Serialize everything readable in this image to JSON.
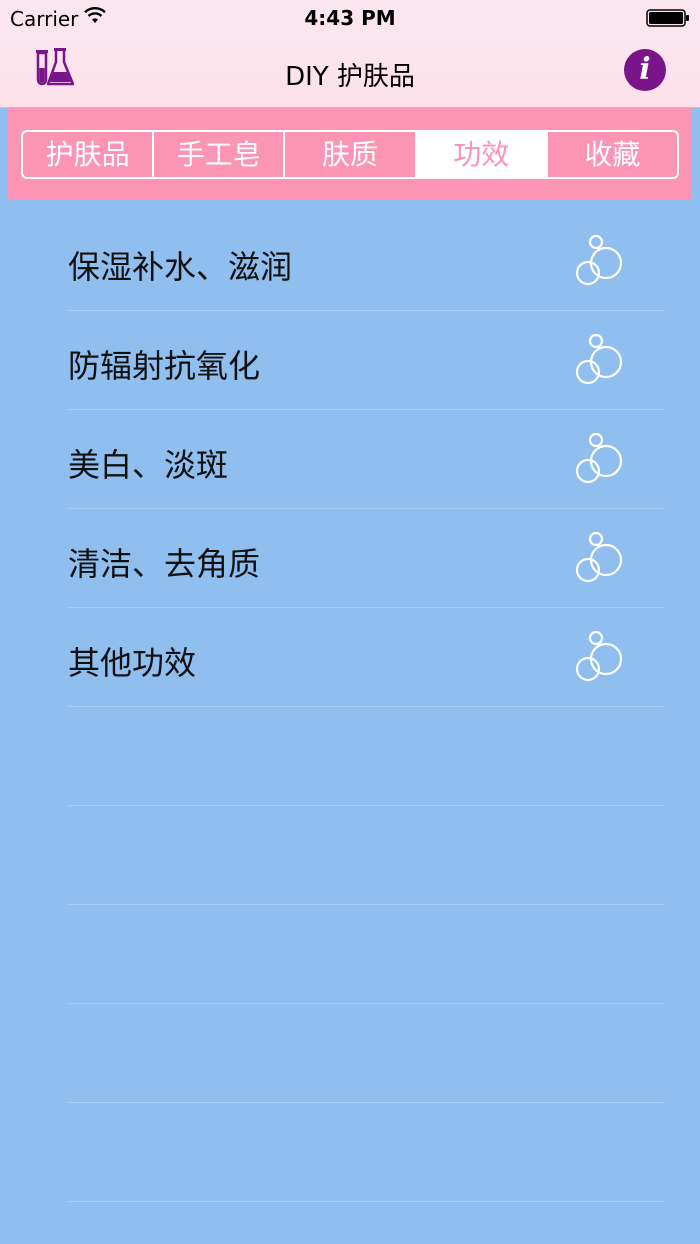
{
  "status_bar": {
    "carrier": "Carrier",
    "time": "4:43 PM"
  },
  "nav_bar": {
    "title": "DIY 护肤品",
    "left_icon": "flask-icon",
    "right_icon": "info-icon",
    "info_glyph": "i",
    "accent_color": "#7a148a"
  },
  "segments": [
    {
      "label": "护肤品",
      "selected": false
    },
    {
      "label": "手工皂",
      "selected": false
    },
    {
      "label": "肤质",
      "selected": false
    },
    {
      "label": "功效",
      "selected": true
    },
    {
      "label": "收藏",
      "selected": false
    }
  ],
  "list": {
    "items": [
      {
        "label": "保湿补水、滋润",
        "icon": "bubbles-icon"
      },
      {
        "label": "防辐射抗氧化",
        "icon": "bubbles-icon"
      },
      {
        "label": "美白、淡斑",
        "icon": "bubbles-icon"
      },
      {
        "label": "清洁、去角质",
        "icon": "bubbles-icon"
      },
      {
        "label": "其他功效",
        "icon": "bubbles-icon"
      }
    ]
  },
  "colors": {
    "background": "#8fbeef",
    "segment_strip": "#fb94b5",
    "nav_bar": "#fbe5ee"
  }
}
